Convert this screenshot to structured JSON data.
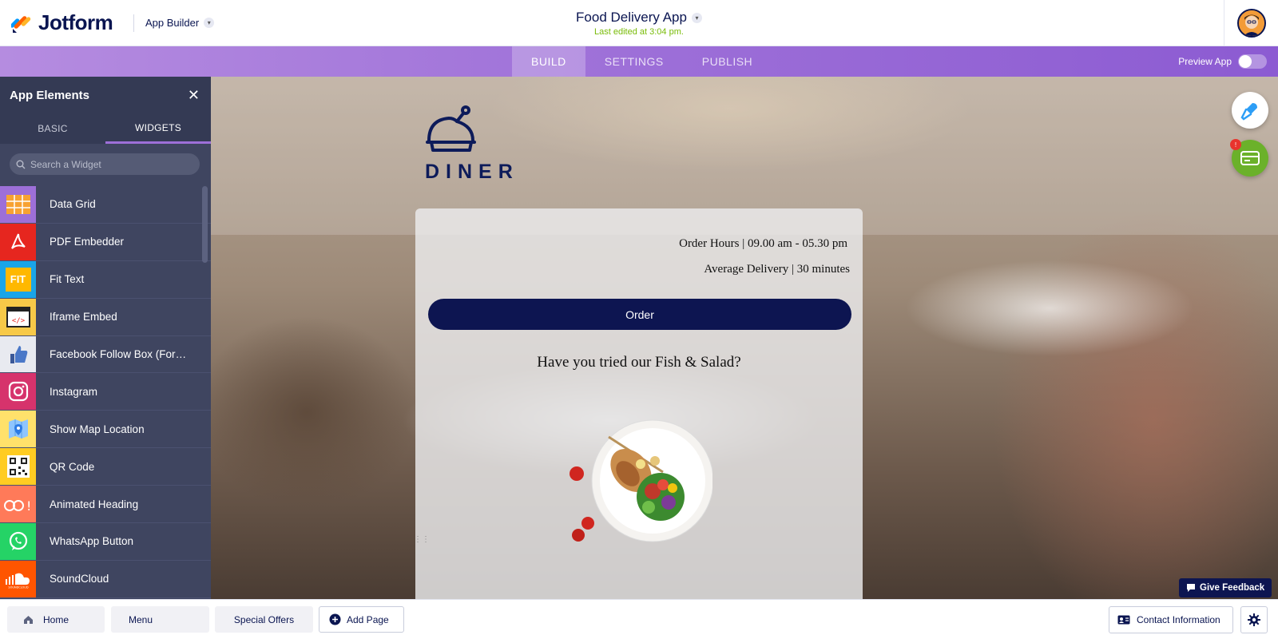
{
  "header": {
    "brand": "Jotform",
    "app_builder_label": "App Builder",
    "app_title": "Food Delivery App",
    "last_edited": "Last edited at 3:04 pm."
  },
  "nav": {
    "tabs": [
      {
        "label": "BUILD",
        "active": true
      },
      {
        "label": "SETTINGS",
        "active": false
      },
      {
        "label": "PUBLISH",
        "active": false
      }
    ],
    "preview_label": "Preview App",
    "preview_on": false
  },
  "sidebar": {
    "title": "App Elements",
    "tabs": [
      {
        "label": "BASIC",
        "active": false
      },
      {
        "label": "WIDGETS",
        "active": true
      }
    ],
    "search_placeholder": "Search a Widget",
    "widgets": [
      {
        "label": "Data Grid",
        "icon": "data-grid-icon",
        "color": "#f7a232"
      },
      {
        "label": "PDF Embedder",
        "icon": "pdf-icon",
        "color": "#e6261f"
      },
      {
        "label": "Fit Text",
        "icon": "fit-text-icon",
        "color": "#ffb800"
      },
      {
        "label": "Iframe Embed",
        "icon": "iframe-embed-icon",
        "color": "#f7c948"
      },
      {
        "label": "Facebook Follow Box (Form...",
        "icon": "thumbs-up-icon",
        "color": "#e8eaf0"
      },
      {
        "label": "Instagram",
        "icon": "instagram-icon",
        "color": "#d6336c"
      },
      {
        "label": "Show Map Location",
        "icon": "map-icon",
        "color": "#ffe16b"
      },
      {
        "label": "QR Code",
        "icon": "qr-code-icon",
        "color": "#ffcc22"
      },
      {
        "label": "Animated Heading",
        "icon": "animated-heading-icon",
        "color": "#ff7a59"
      },
      {
        "label": "WhatsApp Button",
        "icon": "whatsapp-icon",
        "color": "#25d366"
      },
      {
        "label": "SoundCloud",
        "icon": "soundcloud-icon",
        "color": "#ff5500"
      }
    ]
  },
  "canvas": {
    "logo_text": "DINER",
    "order_hours": "Order Hours | 09.00 am - 05.30 pm",
    "avg_delivery": "Average Delivery | 30 minutes",
    "order_button": "Order",
    "promo_text": "Have you tried our Fish & Salad?",
    "notification_count": "!",
    "feedback_label": "Give Feedback"
  },
  "bottom": {
    "pages": [
      "Home",
      "Menu",
      "Special Offers"
    ],
    "add_page": "Add Page",
    "contact_info": "Contact Information"
  },
  "colors": {
    "brand_navy": "#0d1551",
    "nav_purple": "#9d6fd8",
    "sidebar_bg": "#3f4560",
    "last_edited_green": "#78bb07"
  }
}
